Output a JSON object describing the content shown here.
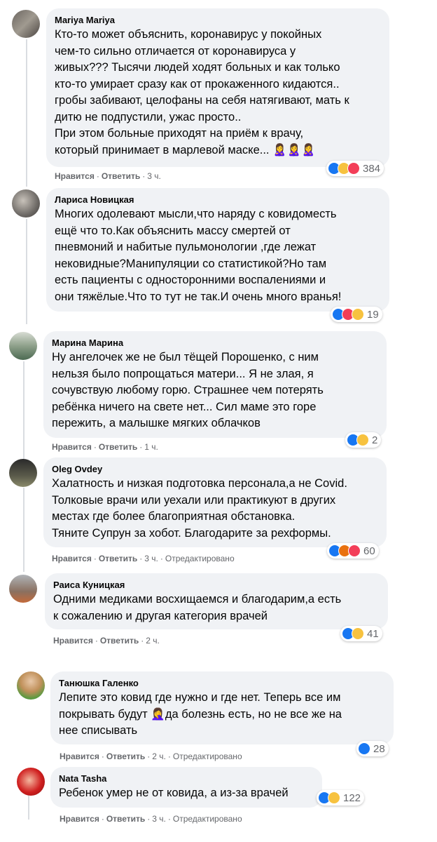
{
  "comments": [
    {
      "author": "Mariya Mariya",
      "text": "Кто-то может объяснить, коронавирус у покойных\nчем-то сильно отличается от коронавируса у\nживых??? Тысячи людей ходят больных и как только\nкто-то умирает сразу как от прокаженного кидаются..\nгробы забивают, целофаны на себя натягивают, мать к\nдитю не подпустили, ужас просто..\nПри этом больные приходят на приём к врачу,\nкоторый принимает в марлевой маске... 🙎‍♀️🙎‍♀️🙎‍♀️",
      "like": "Нравится",
      "reply": "Ответить",
      "time": "3 ч.",
      "edited": "",
      "reactions": [
        "like",
        "sad",
        "love"
      ],
      "count": "384"
    },
    {
      "author": "Лариса Новицкая",
      "text": "Многих одолевают мысли,что наряду с ковидоместь\nещё что то.Как объяснить массу смертей от\nпневмоний и набитые пульмонологии ,где лежат\nнековидные?Манипуляции со статистикой?Но там\nесть пациенты с односторонними воспалениями и\nони тяжёлые.Что то тут не так.И очень много вранья!",
      "like": "",
      "reply": "",
      "time": "",
      "edited": "",
      "reactions": [
        "like",
        "love",
        "wow"
      ],
      "count": "19"
    },
    {
      "author": "Марина Марина",
      "text": "Ну ангелочек же не был тёщей Порошенко, с ним\nнельзя было попрощаться матери... Я не злая, я\nсочувствую любому горю. Страшнее чем потерять\nребёнка ничего на свете нет... Сил маме это горе\nпережить, а малышке мягких облачков",
      "like": "Нравится",
      "reply": "Ответить",
      "time": "1 ч.",
      "edited": "",
      "reactions": [
        "like",
        "sad"
      ],
      "count": "2"
    },
    {
      "author": "Oleg Ovdey",
      "text": "Халатность и низкая подготовка персонала,а не Covid.\nТолковые врачи или уехали или практикуют в других\nместах где более благоприятная обстановка.\nТяните Супрун за хобот. Благодарите за рехформы.",
      "like": "Нравится",
      "reply": "Ответить",
      "time": "3 ч.",
      "edited": "Отредактировано",
      "reactions": [
        "like",
        "angry",
        "love"
      ],
      "count": "60"
    },
    {
      "author": "Раиса Куницкая",
      "text": "Одними медиками восхищаемся и благодарим,а есть\nк сожалению и другая категория врачей",
      "like": "Нравится",
      "reply": "Ответить",
      "time": "2 ч.",
      "edited": "",
      "reactions": [
        "like",
        "sad"
      ],
      "count": "41"
    },
    {
      "author": "Танюшка Галенко",
      "text": "Лепите это ковид где нужно и где нет. Теперь все им\nпокрывать будут 🤦‍♀️да болезнь есть, но не все же на\nнее списывать",
      "like": "Нравится",
      "reply": "Ответить",
      "time": "2 ч.",
      "edited": "Отредактировано",
      "reactions": [
        "like"
      ],
      "count": "28"
    },
    {
      "author": "Nata Tasha",
      "text": "Ребенок умер не от ковида, а из-за врачей",
      "like": "Нравится",
      "reply": "Ответить",
      "time": "3 ч.",
      "edited": "Отредактировано",
      "reactions": [
        "like",
        "sad"
      ],
      "count": "122"
    }
  ],
  "colors": {
    "like": "#1877f2",
    "sad": "#f7c23f",
    "love": "#f33e58",
    "angry": "#e9710f",
    "bubble": "#f0f2f5"
  }
}
